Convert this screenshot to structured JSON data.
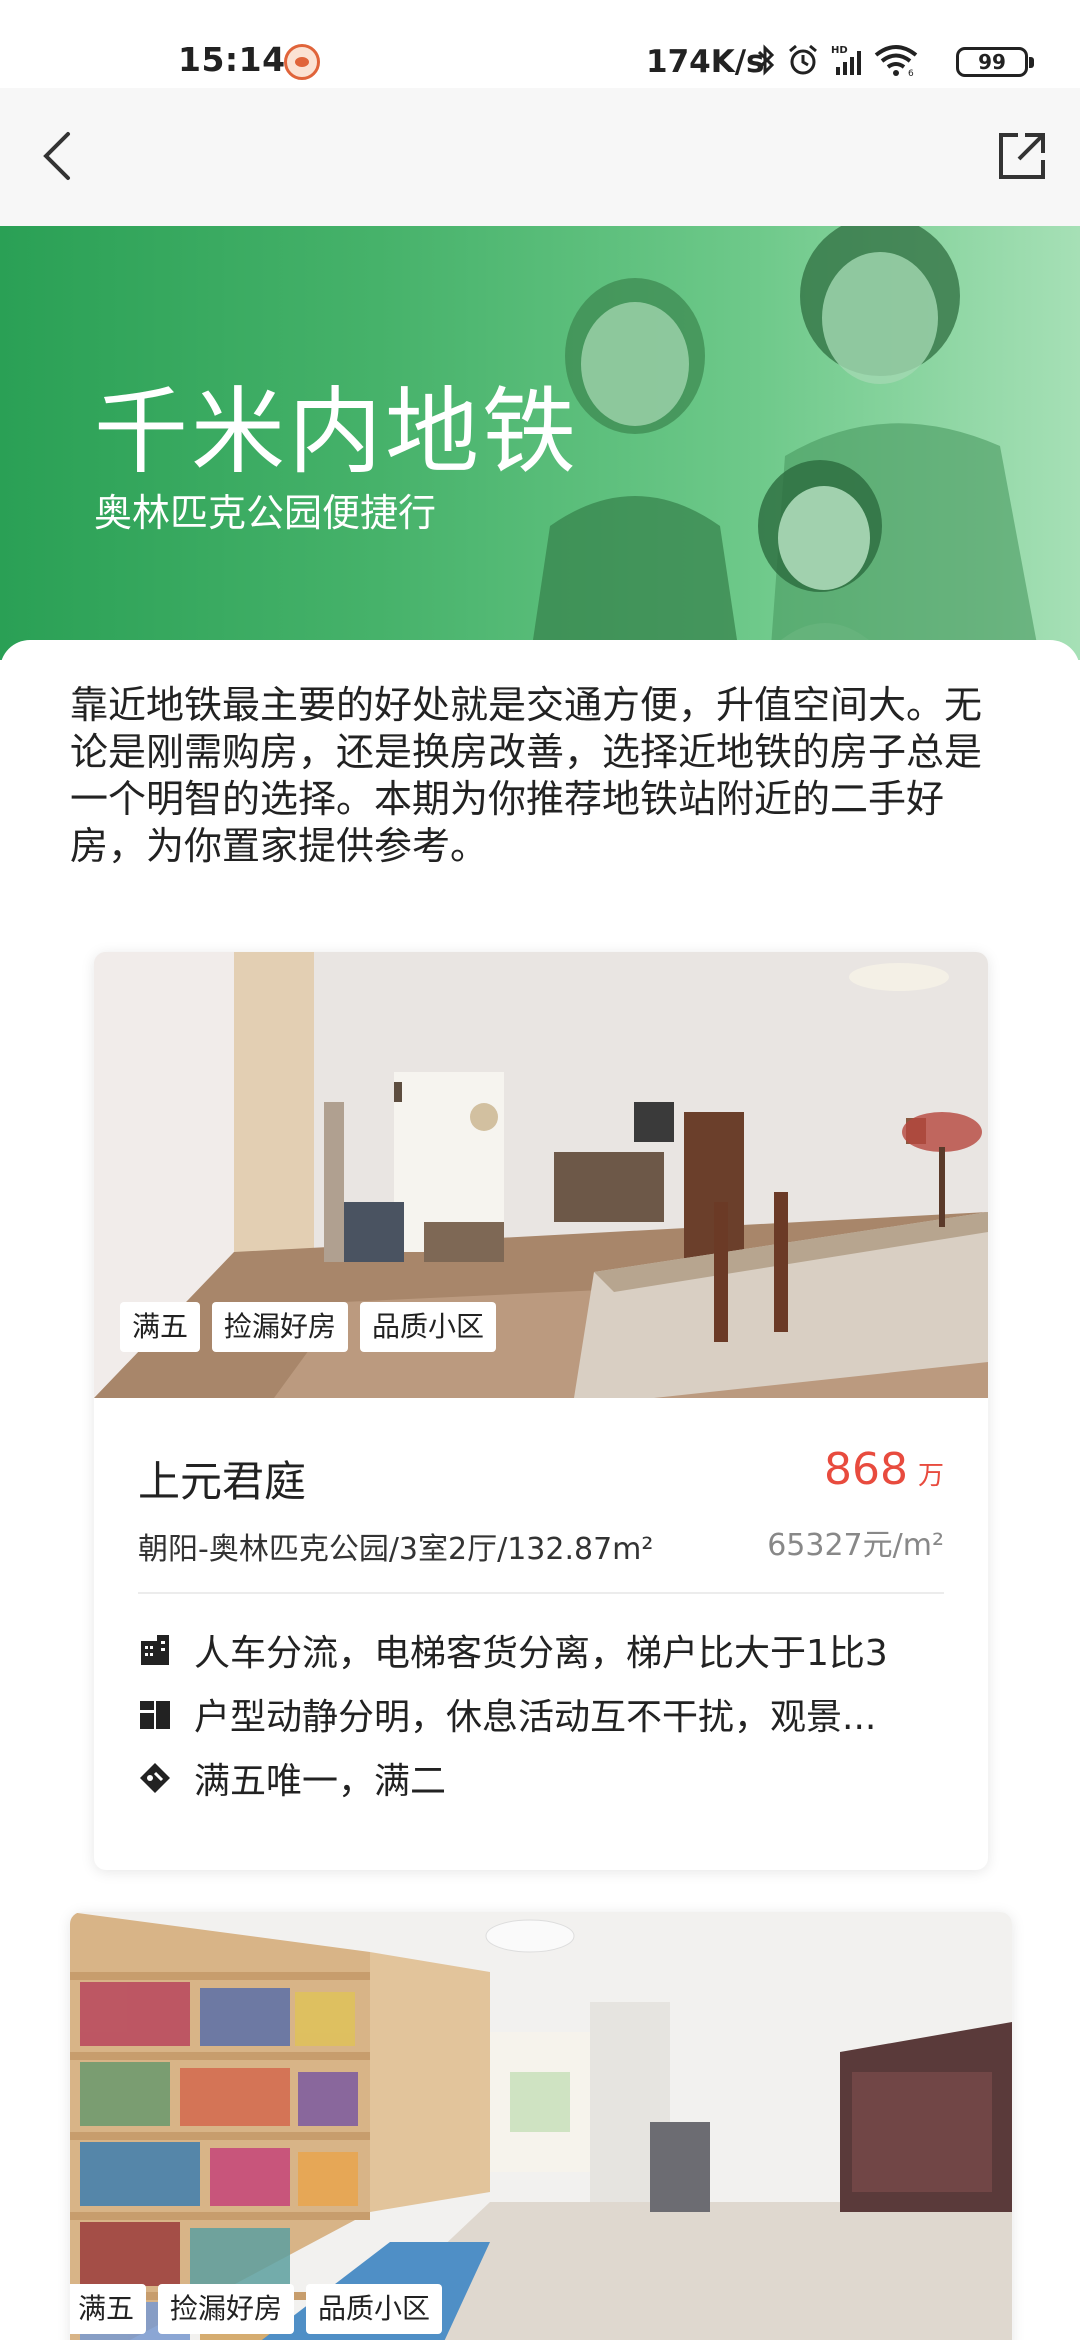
{
  "status_bar": {
    "time": "15:14",
    "net_speed": "174K/s",
    "battery": "99",
    "icons": [
      "app-notification-icon",
      "bluetooth-icon",
      "alarm-icon",
      "hd-signal-icon",
      "wifi-icon",
      "battery-icon"
    ]
  },
  "nav": {
    "back_icon": "back-icon",
    "share_icon": "share-icon"
  },
  "banner": {
    "title": "千米内地铁",
    "subtitle": "奥林匹克公园便捷行"
  },
  "intro": "靠近地铁最主要的好处就是交通方便，升值空间大。无论是刚需购房，还是换房改善，选择近地铁的房子总是一个明智的选择。本期为你推荐地铁站附近的二手好房，为你置家提供参考。",
  "listings": [
    {
      "tags": [
        "满五",
        "捡漏好房",
        "品质小区"
      ],
      "title": "上元君庭",
      "price": "868",
      "price_unit": "万",
      "description": "朝阳-奥林匹克公园/3室2厅/132.87m²",
      "unit_price": "65327元/m²",
      "features": [
        {
          "icon": "building-icon",
          "text": "人车分流，电梯客货分离，梯户比大于1比3"
        },
        {
          "icon": "floorplan-icon",
          "text": "户型动静分明，休息活动互不干扰，观景..."
        },
        {
          "icon": "tag-icon",
          "text": "满五唯一，满二"
        }
      ]
    },
    {
      "tags": [
        "满五",
        "捡漏好房",
        "品质小区"
      ]
    }
  ],
  "colors": {
    "banner_green": "#2aa055",
    "price_red": "#e84b3e",
    "nav_bg": "#f7f7f7"
  }
}
